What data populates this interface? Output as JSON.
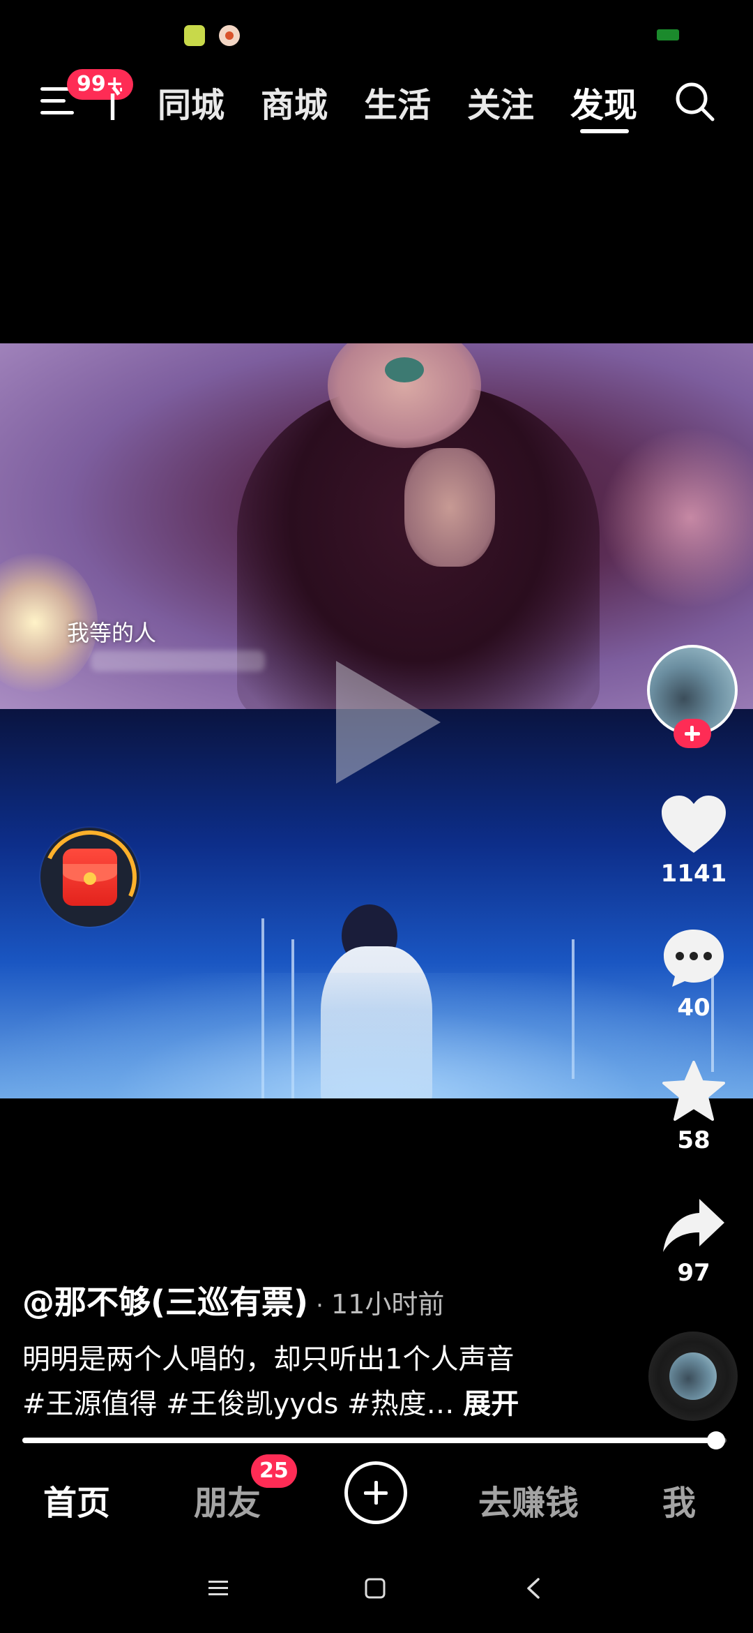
{
  "top_nav": {
    "menu_badge": "99+",
    "partial_tab": "门",
    "tabs": [
      {
        "label": "同城"
      },
      {
        "label": "商城"
      },
      {
        "label": "生活"
      },
      {
        "label": "关注"
      },
      {
        "label": "发现"
      }
    ],
    "active_tab": "发现"
  },
  "video": {
    "subtitle": "我等的人"
  },
  "actions": {
    "likes": "1141",
    "comments": "40",
    "favorites": "58",
    "shares": "97"
  },
  "caption": {
    "author": "@那不够(三巡有票)",
    "separator": "·",
    "time": "11小时前",
    "line1": "明明是两个人唱的，却只听出1个人声音",
    "line2": "#王源值得 #王俊凯yyds #热度… ",
    "expand": "展开"
  },
  "progress": {
    "value": 0.985
  },
  "bottom_nav": {
    "home": "首页",
    "friends": "朋友",
    "friends_badge": "25",
    "earn": "去赚钱",
    "me": "我"
  },
  "colors": {
    "accent": "#fe2c55",
    "background": "#000000"
  },
  "icons": [
    "menu-icon",
    "search-icon",
    "play-icon",
    "heart-icon",
    "comment-icon",
    "star-icon",
    "share-icon",
    "plus-icon",
    "red-packet-icon"
  ]
}
